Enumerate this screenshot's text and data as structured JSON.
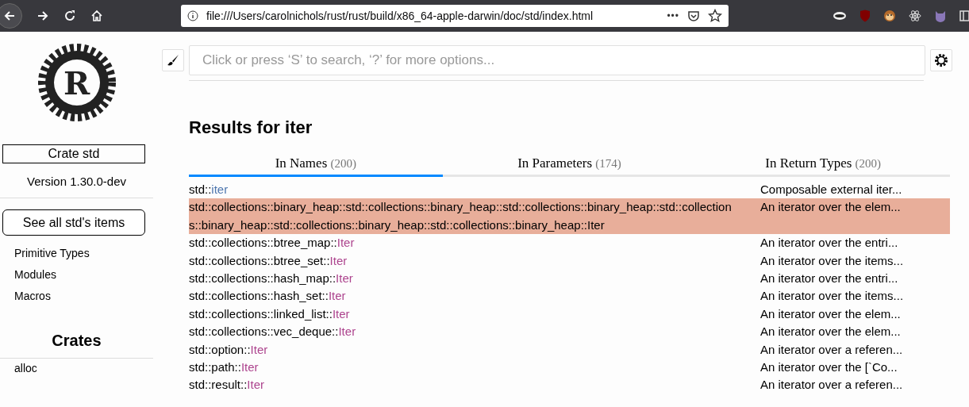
{
  "browser": {
    "url": "file:///Users/carolnichols/rust/rust/build/x86_64-apple-darwin/doc/std/index.html",
    "more": "•••"
  },
  "sidebar": {
    "logo_letter": "R",
    "crate_title": "Crate std",
    "version": "Version 1.30.0-dev",
    "all_items_button": "See all std's items",
    "links": [
      "Primitive Types",
      "Modules",
      "Macros"
    ],
    "crates_heading": "Crates",
    "crates": [
      "alloc"
    ]
  },
  "search": {
    "placeholder": "Click or press ‘S’ to search, ‘?’ for more options..."
  },
  "results_title": "Results for iter",
  "tabs": [
    {
      "label": "In Names",
      "count": "(200)",
      "selected": true
    },
    {
      "label": "In Parameters",
      "count": "(174)",
      "selected": false
    },
    {
      "label": "In Return Types",
      "count": "(200)",
      "selected": false
    }
  ],
  "results": [
    {
      "path": "std::",
      "name": "iter",
      "kind": "mod",
      "desc": "Composable external iter...",
      "selected": false
    },
    {
      "path": "std::collections::binary_heap::std::collections::binary_heap::std::collections::binary_heap::std::collections::binary_heap::std::collections::binary_heap::std::collections::binary_heap::",
      "name": "Iter",
      "kind": "struct",
      "desc": "An iterator over the elem...",
      "selected": true
    },
    {
      "path": "std::collections::btree_map::",
      "name": "Iter",
      "kind": "struct",
      "desc": "An iterator over the entri...",
      "selected": false
    },
    {
      "path": "std::collections::btree_set::",
      "name": "Iter",
      "kind": "struct",
      "desc": "An iterator over the items...",
      "selected": false
    },
    {
      "path": "std::collections::hash_map::",
      "name": "Iter",
      "kind": "struct",
      "desc": "An iterator over the entri...",
      "selected": false
    },
    {
      "path": "std::collections::hash_set::",
      "name": "Iter",
      "kind": "struct",
      "desc": "An iterator over the items...",
      "selected": false
    },
    {
      "path": "std::collections::linked_list::",
      "name": "Iter",
      "kind": "struct",
      "desc": "An iterator over the elem...",
      "selected": false
    },
    {
      "path": "std::collections::vec_deque::",
      "name": "Iter",
      "kind": "struct",
      "desc": "An iterator over the elem...",
      "selected": false
    },
    {
      "path": "std::option::",
      "name": "Iter",
      "kind": "struct",
      "desc": "An iterator over a referen...",
      "selected": false
    },
    {
      "path": "std::path::",
      "name": "Iter",
      "kind": "struct",
      "desc": "An iterator over the [`Co...",
      "selected": false
    },
    {
      "path": "std::result::",
      "name": "Iter",
      "kind": "struct",
      "desc": "An iterator over a referen...",
      "selected": false
    }
  ]
}
